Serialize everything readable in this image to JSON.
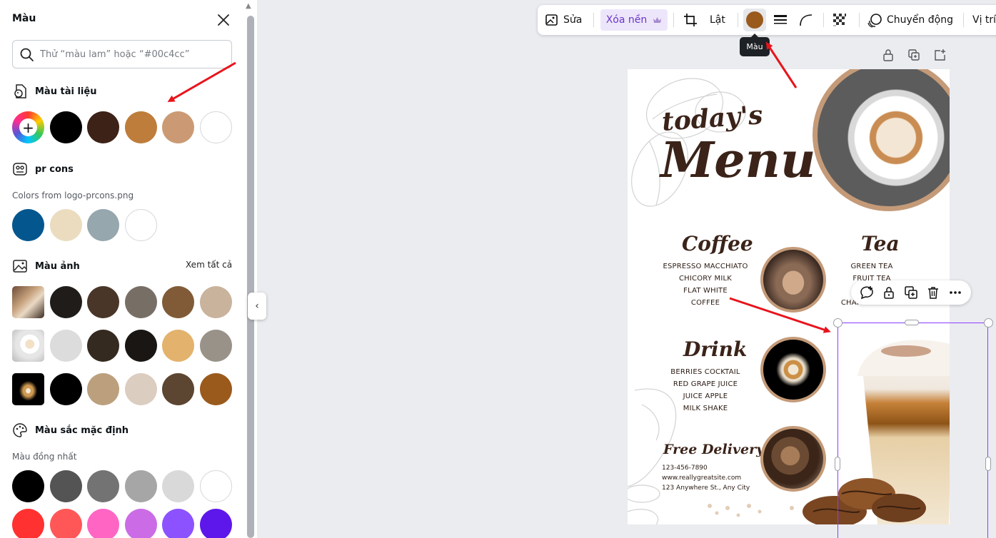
{
  "panel": {
    "title": "Màu",
    "search_placeholder": "Thử “màu lam” hoặc “#00c4cc”",
    "document_colors": {
      "title": "Màu tài liệu",
      "swatches": [
        "#000000",
        "#3d2217",
        "#be7d3b",
        "#cb9a74",
        "#ffffff"
      ]
    },
    "brand_kit": {
      "title": "pr cons",
      "subtitle": "Colors from logo-prcons.png",
      "swatches": [
        "#04568f",
        "#ebdcc0",
        "#96a7ae",
        "#ffffff"
      ]
    },
    "photo_colors": {
      "title": "Màu ảnh",
      "see_all": "Xem tất cả",
      "rows": [
        [
          "#201c19",
          "#4a3629",
          "#776f66",
          "#815b38",
          "#c9b39d"
        ],
        [
          "#dcdcdc",
          "#352a20",
          "#1a1613",
          "#e3b26d",
          "#999289"
        ],
        [
          "#000000",
          "#bca07e",
          "#dbcdc0",
          "#5c4531",
          "#9a5a1c"
        ]
      ]
    },
    "default_colors": {
      "title": "Màu sắc mặc định",
      "subtitle": "Màu đồng nhất",
      "rows": [
        [
          "#000000",
          "#545454",
          "#737373",
          "#a6a6a6",
          "#d9d9d9",
          "#ffffff"
        ],
        [
          "#ff3131",
          "#ff5757",
          "#ff66c4",
          "#cb6ce6",
          "#8c52ff",
          "#5e17eb"
        ]
      ]
    }
  },
  "toolbar": {
    "edit_label": "Sửa",
    "remove_bg_label": "Xóa nền",
    "flip_label": "Lật",
    "color_value": "#9a5a1c",
    "color_tooltip": "Màu",
    "animate_label": "Chuyển động",
    "position_label": "Vị trí"
  },
  "design": {
    "title_small": "today's",
    "title_big": "Menu",
    "coffee": {
      "heading": "Coffee",
      "items": [
        "ESPRESSO MACCHIATO",
        "CHICORY MILK",
        "FLAT WHITE",
        "COFFEE"
      ]
    },
    "tea": {
      "heading": "Tea",
      "items": [
        "GREEN TEA",
        "FRUIT TEA",
        "B",
        "CHAMOMILE TEA"
      ]
    },
    "drink": {
      "heading": "Drink",
      "items": [
        "BERRIES COCKTAIL",
        "RED GRAPE JUICE",
        "JUICE APPLE",
        "MILK SHAKE"
      ]
    },
    "delivery": {
      "heading": "Free Delivery",
      "phone": "123-456-7890",
      "website": "www.reallygreatsite.com",
      "address": "123 Anywhere St., Any City"
    }
  },
  "colors": {
    "accent_purple": "#8b3dff",
    "annotation_red": "#e8141c"
  }
}
